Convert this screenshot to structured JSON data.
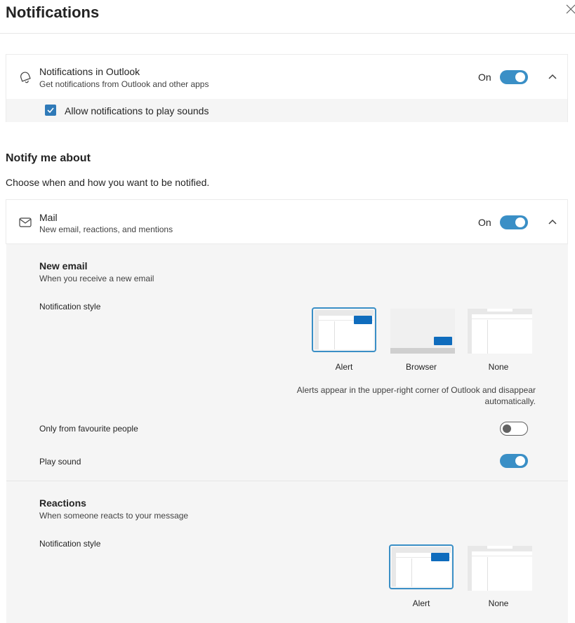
{
  "header": {
    "title": "Notifications"
  },
  "outlook_card": {
    "title": "Notifications in Outlook",
    "subtitle": "Get notifications from Outlook and other apps",
    "status": "On",
    "allow_sounds_label": "Allow notifications to play sounds"
  },
  "notify_section": {
    "title": "Notify me about",
    "description": "Choose when and how you want to be notified."
  },
  "mail_card": {
    "title": "Mail",
    "subtitle": "New email, reactions, and mentions",
    "status": "On"
  },
  "new_email": {
    "title": "New email",
    "subtitle": "When you receive a new email",
    "style_label": "Notification style",
    "options": [
      "Alert",
      "Browser",
      "None"
    ],
    "selected_option": "Alert",
    "helper": "Alerts appear in the upper-right corner of Outlook and disappear automatically.",
    "favourite_label": "Only from favourite people",
    "favourite_on": false,
    "sound_label": "Play sound",
    "sound_on": true
  },
  "reactions": {
    "title": "Reactions",
    "subtitle": "When someone reacts to your message",
    "style_label": "Notification style",
    "options": [
      "Alert",
      "None"
    ],
    "selected_option": "Alert"
  },
  "colors": {
    "accent": "#3a8fc6",
    "alert_blue": "#0f6cbd",
    "panel_bg": "#f5f5f5"
  }
}
